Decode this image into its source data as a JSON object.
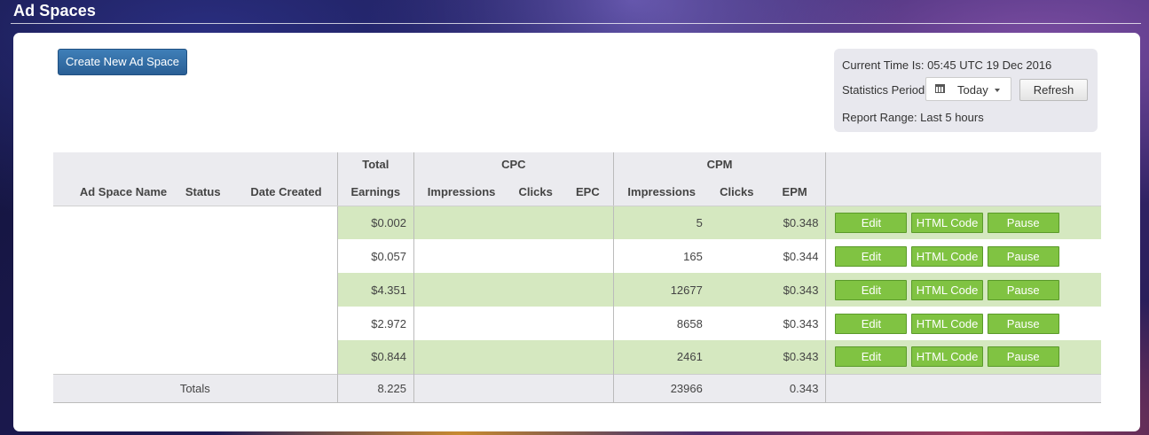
{
  "page": {
    "title": "Ad Spaces"
  },
  "toolbar": {
    "create_label": "Create New Ad Space"
  },
  "stats": {
    "current_time": "Current Time Is: 05:45 UTC 19 Dec 2016",
    "period_label": "Statistics Period",
    "period_value": "Today",
    "refresh_label": "Refresh",
    "report_range": "Report Range: Last 5 hours"
  },
  "table": {
    "group_headers": {
      "total": "Total",
      "cpc": "CPC",
      "cpm": "CPM"
    },
    "columns": {
      "name": "Ad Space Name",
      "status": "Status",
      "date": "Date Created",
      "earnings": "Earnings",
      "cpc_impressions": "Impressions",
      "cpc_clicks": "Clicks",
      "epc": "EPC",
      "cpm_impressions": "Impressions",
      "cpm_clicks": "Clicks",
      "epm": "EPM"
    },
    "rows": [
      {
        "earnings": "$0.002",
        "cpm_impressions": "5",
        "epm": "$0.348"
      },
      {
        "earnings": "$0.057",
        "cpm_impressions": "165",
        "epm": "$0.344"
      },
      {
        "earnings": "$4.351",
        "cpm_impressions": "12677",
        "epm": "$0.343"
      },
      {
        "earnings": "$2.972",
        "cpm_impressions": "8658",
        "epm": "$0.343"
      },
      {
        "earnings": "$0.844",
        "cpm_impressions": "2461",
        "epm": "$0.343"
      }
    ],
    "actions": {
      "edit": "Edit",
      "html": "HTML Code",
      "pause": "Pause"
    },
    "totals": {
      "label": "Totals",
      "earnings": "8.225",
      "cpm_impressions": "23966",
      "epm": "0.343"
    }
  },
  "colors": {
    "row_green": "#d5e8c0",
    "action_green": "#80c342",
    "primary_blue": "#2a5f95",
    "header_gray": "#ebebef"
  }
}
